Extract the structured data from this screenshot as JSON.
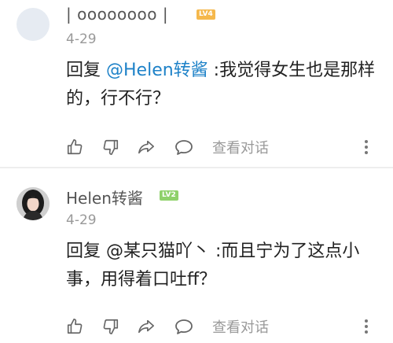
{
  "comments": [
    {
      "username": "| oooooooo |",
      "level": "LV4",
      "date": "4-29",
      "reply_prefix": "回复 ",
      "mention": "@Helen转酱",
      "text": " :我觉得女生也是那样的，行不行？",
      "actions": {
        "view_dialog": "查看对话"
      }
    },
    {
      "username": "Helen转酱",
      "level": "LV2",
      "date": "4-29",
      "reply_prefix": "回复 ",
      "mention": "@某只猫吖丶",
      "text": " :而且宁为了这点小事，用得着口吐ff？",
      "actions": {
        "view_dialog": "查看对话"
      }
    }
  ],
  "colors": {
    "mention_blue": "#1e82c8",
    "lv4_badge": "#f5b84c",
    "lv2_badge": "#8fd16b",
    "secondary_text": "#999999"
  },
  "icons": [
    "thumbs-up-icon",
    "thumbs-down-icon",
    "share-icon",
    "comment-icon",
    "more-vertical-icon"
  ]
}
